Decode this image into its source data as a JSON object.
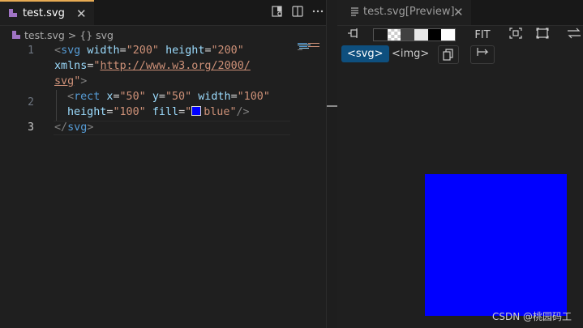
{
  "editor": {
    "tab_label": "test.svg",
    "close_glyph": "✕",
    "breadcrumb": {
      "file": "test.svg",
      "sep": ">",
      "symbol": "{} svg"
    },
    "line_numbers": [
      "1",
      "",
      "",
      "2",
      "",
      "3"
    ],
    "code": {
      "l1a": {
        "open": "<",
        "tag": "svg",
        "a1": "width",
        "v1": "\"200\"",
        "a2": "height",
        "v2": "\"200\""
      },
      "l1b": {
        "a3": "xmlns",
        "v3a": "\"",
        "url1": "http://www.w3.org/2000/"
      },
      "l1c": {
        "url2": "svg",
        "v3b": "\"",
        "close": ">"
      },
      "l2a": {
        "open": "<",
        "tag": "rect",
        "a1": "x",
        "v1": "\"50\"",
        "a2": "y",
        "v2": "\"50\"",
        "a3": "width",
        "v3": "\"100\""
      },
      "l2b": {
        "a4": "height",
        "v4": "\"100\"",
        "a5": "fill",
        "q1": "\"",
        "v5": "blue",
        "q2": "\"",
        "close": "/>"
      },
      "l3": {
        "open": "</",
        "tag": "svg",
        "close": ">"
      }
    },
    "fill_swatch_color": "#0000ff",
    "icons": [
      "svg-file-icon",
      "open-preview-icon",
      "split-editor-icon",
      "more-actions-icon"
    ]
  },
  "preview": {
    "tab_label": "test.svg[Preview]",
    "close_glyph": "✕",
    "toolbar": {
      "fit_label": "FIT"
    },
    "mode_buttons": {
      "svg": "<svg>",
      "img": "<img>"
    },
    "rendered_shape": {
      "fill": "#0000ff"
    }
  },
  "watermark": "CSDN @桃园码工"
}
